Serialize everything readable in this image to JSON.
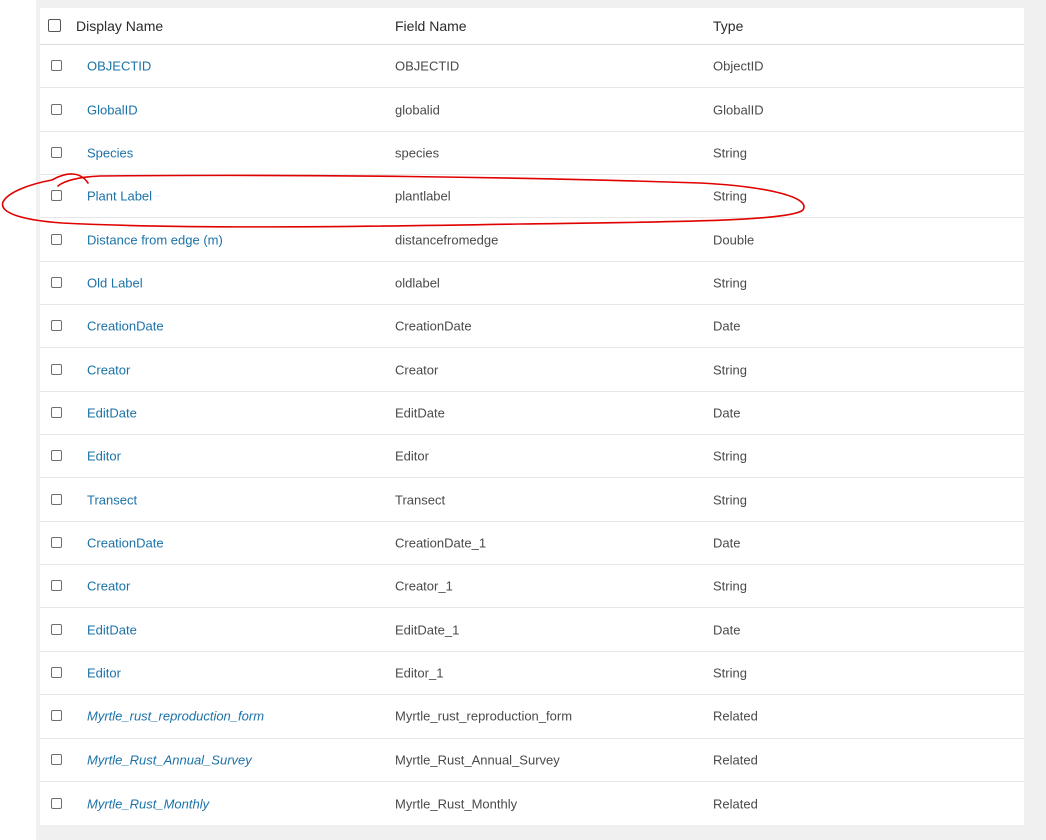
{
  "table": {
    "columns": [
      "Display Name",
      "Field Name",
      "Type"
    ],
    "rows": [
      {
        "display_name": "OBJECTID",
        "field_name": "OBJECTID",
        "type": "ObjectID"
      },
      {
        "display_name": "GlobalID",
        "field_name": "globalid",
        "type": "GlobalID"
      },
      {
        "display_name": "Species",
        "field_name": "species",
        "type": "String"
      },
      {
        "display_name": "Plant Label",
        "field_name": "plantlabel",
        "type": "String"
      },
      {
        "display_name": "Distance from edge (m)",
        "field_name": "distancefromedge",
        "type": "Double"
      },
      {
        "display_name": "Old Label",
        "field_name": "oldlabel",
        "type": "String"
      },
      {
        "display_name": "CreationDate",
        "field_name": "CreationDate",
        "type": "Date"
      },
      {
        "display_name": "Creator",
        "field_name": "Creator",
        "type": "String"
      },
      {
        "display_name": "EditDate",
        "field_name": "EditDate",
        "type": "Date"
      },
      {
        "display_name": "Editor",
        "field_name": "Editor",
        "type": "String"
      },
      {
        "display_name": "Transect",
        "field_name": "Transect",
        "type": "String"
      },
      {
        "display_name": "CreationDate",
        "field_name": "CreationDate_1",
        "type": "Date"
      },
      {
        "display_name": "Creator",
        "field_name": "Creator_1",
        "type": "String"
      },
      {
        "display_name": "EditDate",
        "field_name": "EditDate_1",
        "type": "Date"
      },
      {
        "display_name": "Editor",
        "field_name": "Editor_1",
        "type": "String"
      },
      {
        "display_name": "Myrtle_rust_reproduction_form",
        "field_name": "Myrtle_rust_reproduction_form",
        "type": "Related"
      },
      {
        "display_name": "Myrtle_Rust_Annual_Survey",
        "field_name": "Myrtle_Rust_Annual_Survey",
        "type": "Related"
      },
      {
        "display_name": "Myrtle_Rust_Monthly",
        "field_name": "Myrtle_Rust_Monthly",
        "type": "Related"
      }
    ]
  },
  "colors": {
    "link": "#1b72a8",
    "annotation": "#e00000",
    "page_background": "#f0f0f0"
  }
}
